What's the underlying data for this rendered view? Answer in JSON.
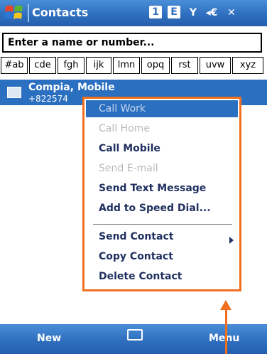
{
  "title_bar": {
    "title": "Contacts",
    "icons": [
      "start-menu-logo",
      "connectivity-icon",
      "signal-icon",
      "volume-icon",
      "close-icon"
    ]
  },
  "search": {
    "value": "Enter a name or number..."
  },
  "alphabet_tabs": [
    "#ab",
    "cde",
    "fgh",
    "ijk",
    "lmn",
    "opq",
    "rst",
    "uvw",
    "xyz"
  ],
  "contact": {
    "name": "Compia, Mobile",
    "number": "+822574"
  },
  "context_menu": {
    "items": [
      {
        "label": "Call Work",
        "enabled": false,
        "highlighted": true
      },
      {
        "label": "Call Home",
        "enabled": false
      },
      {
        "label": "Call Mobile",
        "enabled": true
      },
      {
        "label": "Send E-mail",
        "enabled": false
      },
      {
        "label": "Send Text Message",
        "enabled": true
      },
      {
        "label": "Add to Speed Dial...",
        "enabled": true
      },
      {
        "label": "Send Contact",
        "enabled": true,
        "has_submenu": true
      },
      {
        "label": "Copy Contact",
        "enabled": true
      },
      {
        "label": "Delete Contact",
        "enabled": true
      }
    ]
  },
  "softkeys": {
    "left": "New",
    "right": "Menu"
  },
  "colors": {
    "bar_blue": "#2f6fbf",
    "highlight_orange": "#f07020",
    "selection_blue": "#2b6fc0"
  }
}
